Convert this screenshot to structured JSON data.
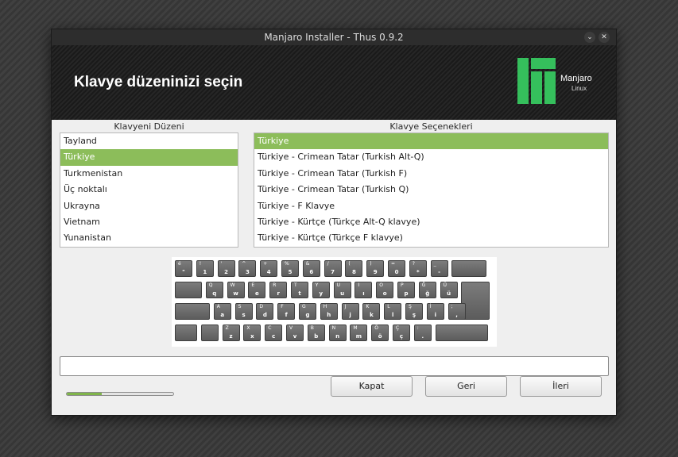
{
  "window": {
    "title": "Manjaro Installer - Thus 0.9.2"
  },
  "titlebar_buttons": {
    "minimize": "⌄",
    "close": "✕"
  },
  "header": {
    "title": "Klavye düzeninizi seçin"
  },
  "logo": {
    "name": "Manjaro",
    "sub": "Linux",
    "color": "#35bf5c"
  },
  "layouts": {
    "label": "Klavyeni Düzeni",
    "items": [
      "Tayland",
      "Türkiye",
      "Turkmenistan",
      "Üç noktalı",
      "Ukrayna",
      "Vietnam",
      "Yunanistan"
    ],
    "selected": "Türkiye"
  },
  "variants": {
    "label": "Klavye Seçenekleri",
    "items": [
      "Türkiye",
      "Türkiye - Crimean Tatar (Turkish Alt-Q)",
      "Türkiye - Crimean Tatar (Turkish F)",
      "Türkiye - Crimean Tatar (Turkish Q)",
      "Türkiye - F Klavye",
      "Türkiye - Kürtçe (Türkçe Alt-Q klavye)",
      "Türkiye - Kürtçe (Türkçe F klavye)"
    ],
    "selected": "Türkiye"
  },
  "keyboard": {
    "rows": [
      [
        [
          "é",
          "\""
        ],
        [
          "!",
          "1"
        ],
        [
          "'",
          "2"
        ],
        [
          "^",
          "3"
        ],
        [
          "+",
          "4"
        ],
        [
          "%",
          "5"
        ],
        [
          "&",
          "6"
        ],
        [
          "/",
          "7"
        ],
        [
          "(",
          "8"
        ],
        [
          ")",
          "9"
        ],
        [
          "=",
          "0"
        ],
        [
          "?",
          "*"
        ],
        [
          "_",
          "-"
        ],
        [
          "",
          ""
        ]
      ],
      [
        [
          "",
          ""
        ],
        [
          "Q",
          "q"
        ],
        [
          "W",
          "w"
        ],
        [
          "E",
          "e"
        ],
        [
          "R",
          "r"
        ],
        [
          "T",
          "t"
        ],
        [
          "Y",
          "y"
        ],
        [
          "U",
          "u"
        ],
        [
          "I",
          "ı"
        ],
        [
          "O",
          "o"
        ],
        [
          "P",
          "p"
        ],
        [
          "Ğ",
          "ğ"
        ],
        [
          "Ü",
          "ü"
        ],
        [
          "",
          ""
        ]
      ],
      [
        [
          "",
          ""
        ],
        [
          "A",
          "a"
        ],
        [
          "S",
          "s"
        ],
        [
          "D",
          "d"
        ],
        [
          "F",
          "f"
        ],
        [
          "G",
          "g"
        ],
        [
          "H",
          "h"
        ],
        [
          "J",
          "j"
        ],
        [
          "K",
          "k"
        ],
        [
          "L",
          "l"
        ],
        [
          "Ş",
          "ş"
        ],
        [
          "İ",
          "i"
        ],
        [
          ";",
          ","
        ]
      ],
      [
        [
          "",
          ""
        ],
        [
          "",
          ""
        ],
        [
          "Z",
          "z"
        ],
        [
          "X",
          "x"
        ],
        [
          "C",
          "c"
        ],
        [
          "V",
          "v"
        ],
        [
          "B",
          "b"
        ],
        [
          "N",
          "n"
        ],
        [
          "M",
          "m"
        ],
        [
          "Ö",
          "ö"
        ],
        [
          "Ç",
          "ç"
        ],
        [
          ":",
          "."
        ],
        [
          "",
          ""
        ]
      ]
    ]
  },
  "test_input": {
    "value": ""
  },
  "progress": {
    "value": 0.33,
    "color": "#7fb54a"
  },
  "buttons": {
    "close": "Kapat",
    "back": "Geri",
    "next": "İleri"
  }
}
